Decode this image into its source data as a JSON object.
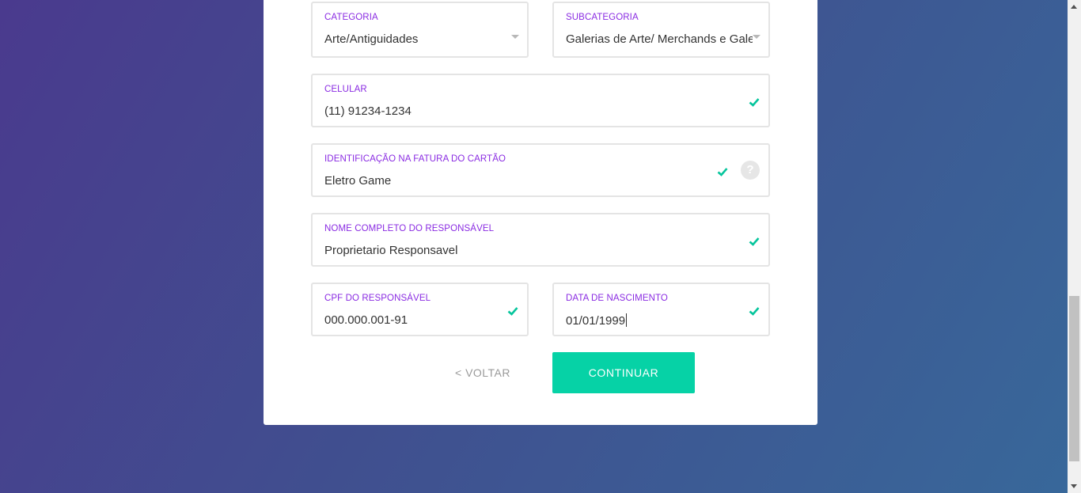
{
  "form": {
    "categoria": {
      "label": "CATEGORIA",
      "value": "Arte/Antiguidades"
    },
    "subcategoria": {
      "label": "SUBCATEGORIA",
      "value": "Galerias de Arte/ Merchands e Galeri"
    },
    "celular": {
      "label": "CELULAR",
      "value": "(11) 91234-1234"
    },
    "identificacao": {
      "label": "IDENTIFICAÇÃO NA FATURA DO CARTÃO",
      "value": "Eletro Game",
      "help_symbol": "?"
    },
    "nome": {
      "label": "NOME COMPLETO DO RESPONSÁVEL",
      "value": "Proprietario Responsavel"
    },
    "cpf": {
      "label": "CPF DO RESPONSÁVEL",
      "value": "000.000.001-91"
    },
    "nascimento": {
      "label": "DATA DE NASCIMENTO",
      "value": "01/01/1999"
    }
  },
  "actions": {
    "back_label": "< VOLTAR",
    "continue_label": "CONTINUAR"
  },
  "colors": {
    "label": "#8a2be2",
    "check": "#06c59c",
    "primary_button": "#06d2a6"
  },
  "icons": {
    "valid": "check-icon",
    "dropdown": "chevron-down-icon",
    "help": "help-icon"
  }
}
